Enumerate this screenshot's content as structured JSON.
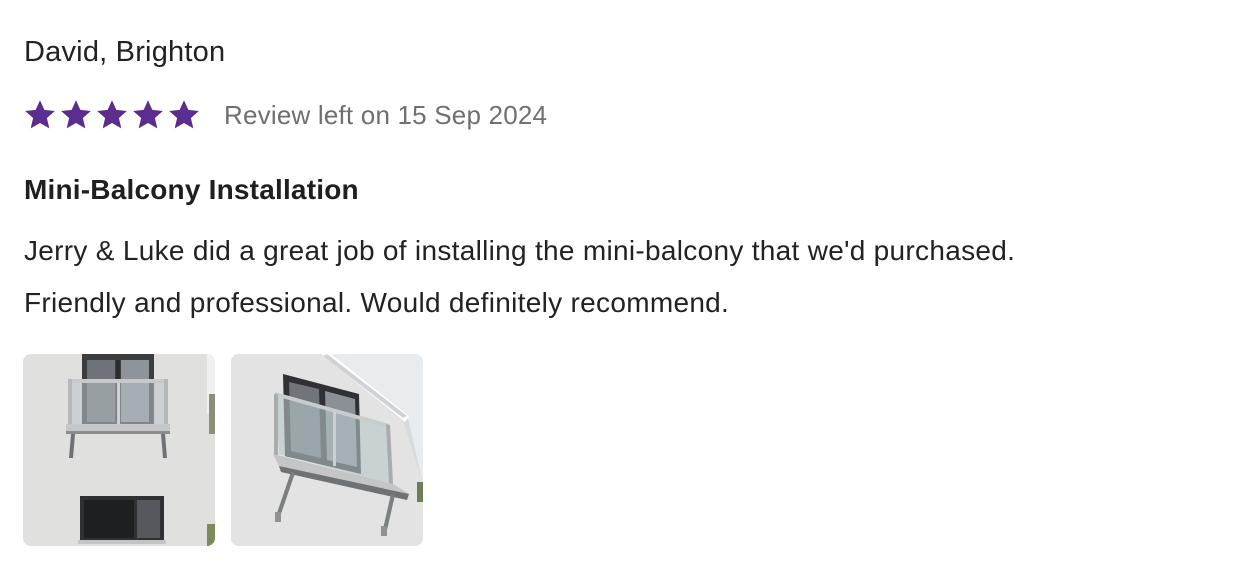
{
  "review": {
    "reviewer": "David, Brighton",
    "rating": 5,
    "rating_max": 5,
    "star_color": "#5b2d8e",
    "date_text": "Review left on 15 Sep 2024",
    "title": "Mini-Balcony Installation",
    "body_line_1": "Jerry & Luke did a great job of installing the mini-balcony that we'd purchased.",
    "body_line_2": "Friendly and professional. Would definitely recommend.",
    "photos": [
      {
        "subject": "mini-balcony front view photo"
      },
      {
        "subject": "mini-balcony angled view photo"
      }
    ]
  }
}
